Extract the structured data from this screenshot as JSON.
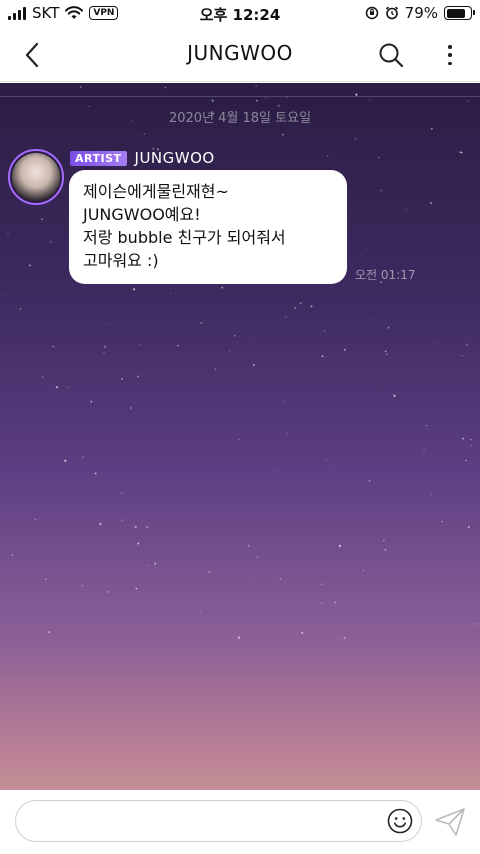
{
  "status_bar": {
    "carrier": "SKT",
    "vpn": "VPN",
    "time": "오후 12:24",
    "battery": "79%",
    "battery_level": 0.79
  },
  "header": {
    "title": "JUNGWOO"
  },
  "chat": {
    "date_divider": "2020년 4월 18일 토요일",
    "message": {
      "badge": "ARTIST",
      "sender": "JUNGWOO",
      "lines": [
        "제이슨에게물린재현~",
        "JUNGWOO예요!",
        "저랑 bubble 친구가 되어줘서",
        "고마워요 :)"
      ],
      "time": "오전 01:17"
    }
  },
  "composer": {
    "placeholder": ""
  },
  "colors": {
    "badge": "#8a5ff0",
    "avatar_ring": "#a66bff",
    "background_top": "#2b1d44",
    "background_bottom": "#c48f96"
  }
}
